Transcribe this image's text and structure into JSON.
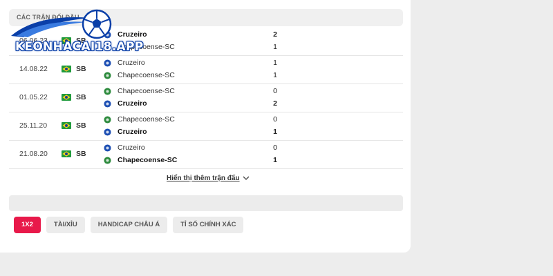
{
  "section": {
    "title": "CÁC TRẬN ĐỐI ĐẦU"
  },
  "logo": {
    "text": "KEONHACAI18.APP"
  },
  "matches": [
    {
      "date": "06.06.23",
      "league": "SB",
      "home": "Cruzeiro",
      "away": "Chapecoense-SC",
      "home_score": "2",
      "away_score": "1",
      "winner": "home"
    },
    {
      "date": "14.08.22",
      "league": "SB",
      "home": "Cruzeiro",
      "away": "Chapecoense-SC",
      "home_score": "1",
      "away_score": "1",
      "winner": "none"
    },
    {
      "date": "01.05.22",
      "league": "SB",
      "home": "Chapecoense-SC",
      "away": "Cruzeiro",
      "home_score": "0",
      "away_score": "2",
      "winner": "away"
    },
    {
      "date": "25.11.20",
      "league": "SB",
      "home": "Chapecoense-SC",
      "away": "Cruzeiro",
      "home_score": "0",
      "away_score": "1",
      "winner": "away"
    },
    {
      "date": "21.08.20",
      "league": "SB",
      "home": "Cruzeiro",
      "away": "Chapecoense-SC",
      "home_score": "0",
      "away_score": "1",
      "winner": "away"
    }
  ],
  "show_more": "Hiển thị thêm trận đấu",
  "tabs": [
    "1X2",
    "TÀI/XỈU",
    "HANDICAP CHÂU Á",
    "TỈ SỐ CHÍNH XÁC"
  ],
  "active_tab": "1X2",
  "colors": {
    "accent": "#e8194a",
    "logo_blue": "#0a3fa8",
    "cruzeiro": "#1d4fb3",
    "chapecoense": "#2e8b3e",
    "brazil_green": "#1f9a3c",
    "brazil_yellow": "#f6d21b"
  },
  "icons": {
    "flag": "brazil-flag-icon",
    "cruzeiro": "cruzeiro-crest-icon",
    "chapecoense": "chapecoense-crest-icon",
    "chevron": "chevron-down-icon",
    "ball": "soccer-ball-icon"
  }
}
